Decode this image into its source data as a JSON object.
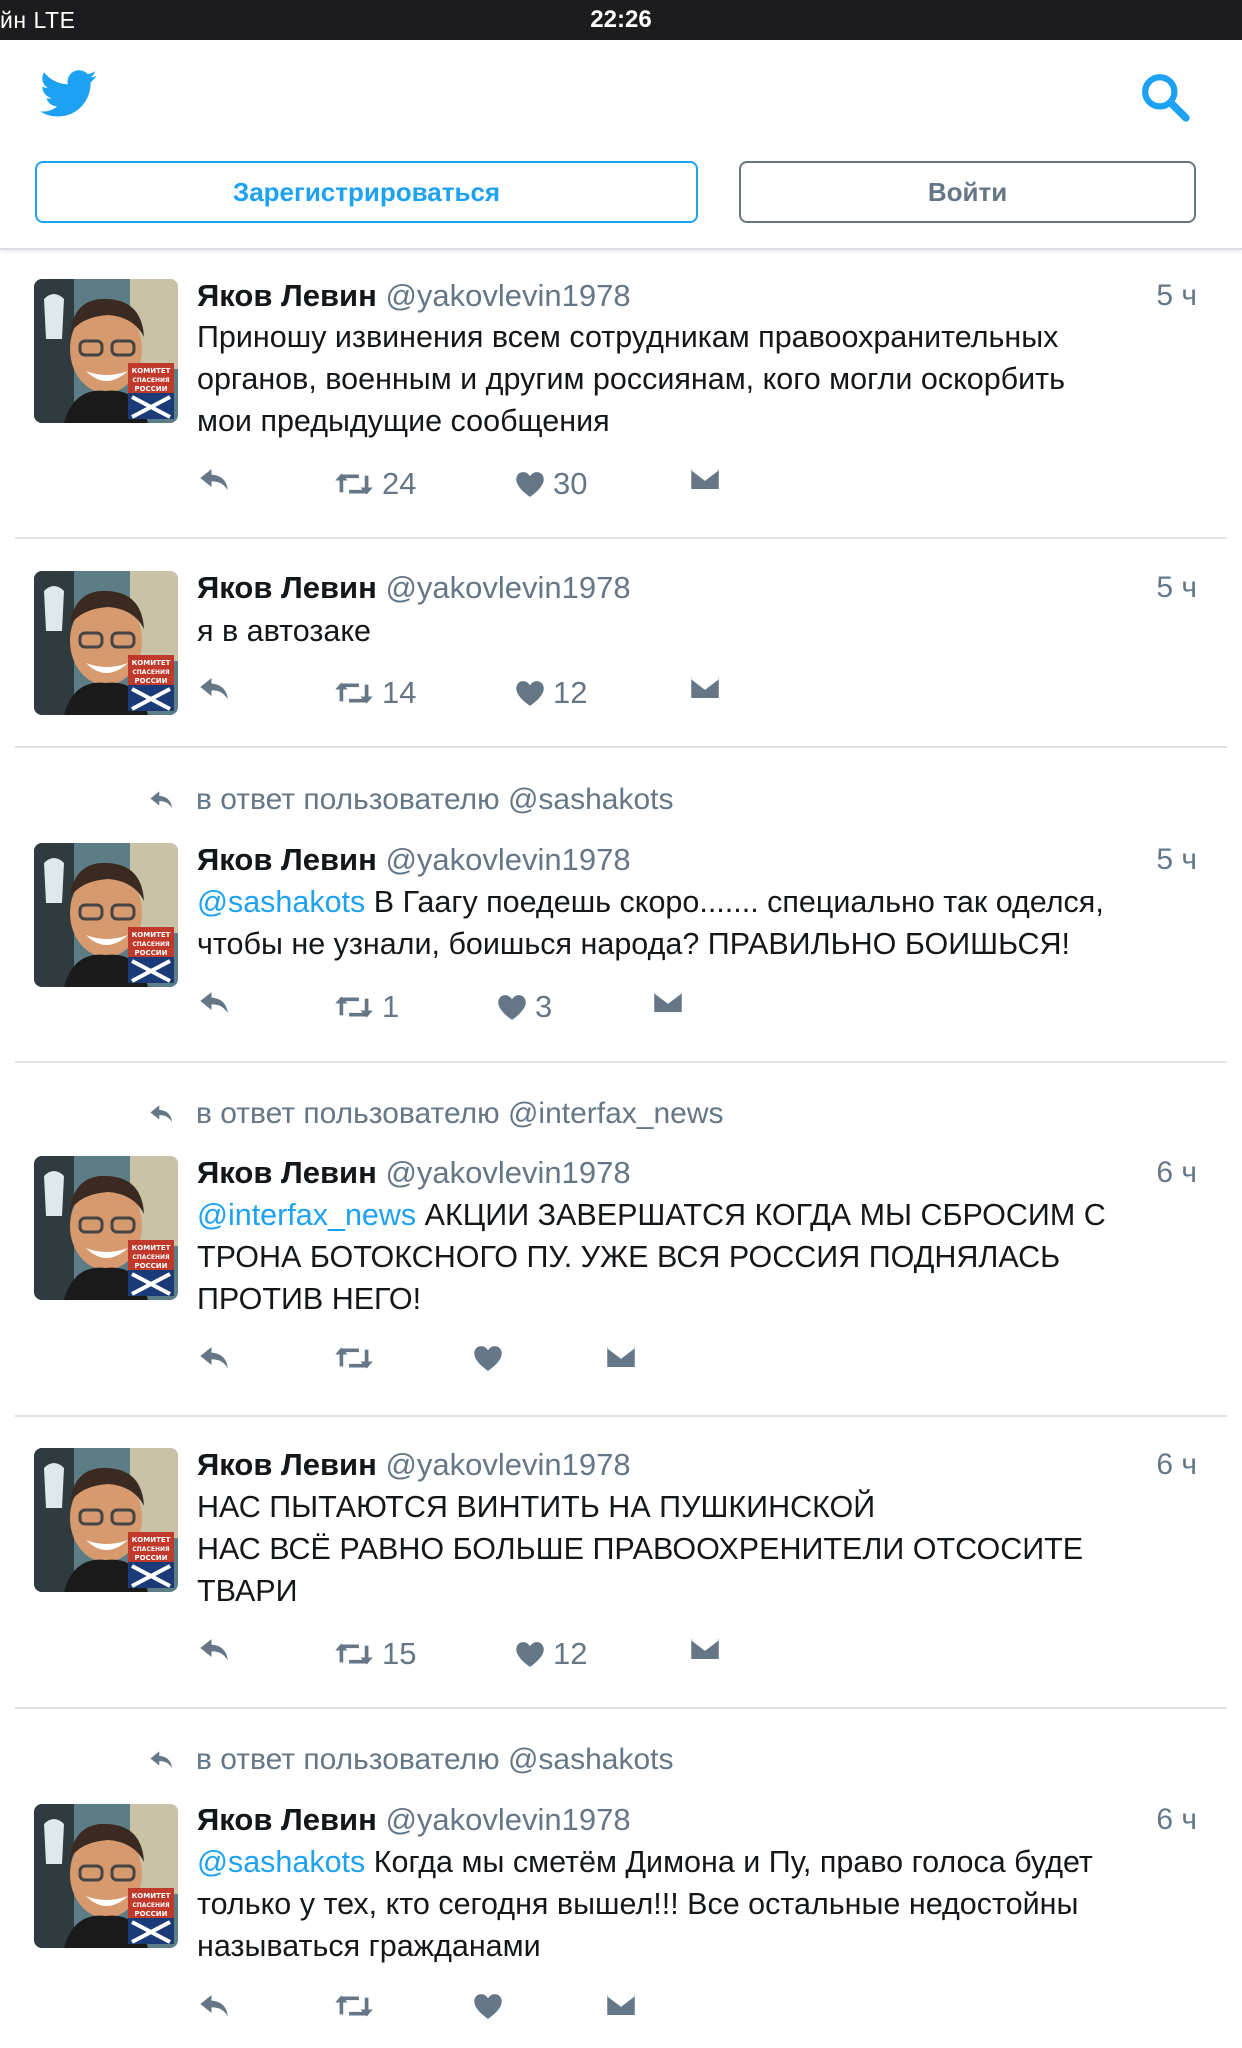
{
  "status_bar": {
    "carrier": "йн  LTE",
    "time": "22:26"
  },
  "header": {
    "signup_label": "Зарегистрироваться",
    "login_label": "Войти"
  },
  "tweets": [
    {
      "name": "Яков Левин",
      "handle": "@yakovlevin1978",
      "time": "5 ч",
      "reply_to": "",
      "mention": "",
      "lines": [
        "Приношу извинения всем сотрудникам правоохранительных",
        "органов, военным и другим россиянам, кого могли оскорбить",
        "мои предыдущие сообщения"
      ],
      "retweets": "24",
      "likes": "30"
    },
    {
      "name": "Яков Левин",
      "handle": "@yakovlevin1978",
      "time": "5 ч",
      "reply_to": "",
      "mention": "",
      "lines": [
        "я в автозаке"
      ],
      "retweets": "14",
      "likes": "12"
    },
    {
      "name": "Яков Левин",
      "handle": "@yakovlevin1978",
      "time": "5 ч",
      "reply_to": "в ответ пользователю @sashakots",
      "mention": "@sashakots",
      "lines": [
        " В Гаагу поедешь скоро....... специально так оделся,",
        "чтобы не узнали, боишься народа? ПРАВИЛЬНО БОИШЬСЯ!"
      ],
      "retweets": "1",
      "likes": "3"
    },
    {
      "name": "Яков Левин",
      "handle": "@yakovlevin1978",
      "time": "6 ч",
      "reply_to": "в ответ пользователю @interfax_news",
      "mention": "@interfax_news",
      "lines": [
        " АКЦИИ ЗАВЕРШАТСЯ КОГДА МЫ СБРОСИМ С",
        "ТРОНА БОТОКСНОГО ПУ. УЖЕ ВСЯ РОССИЯ ПОДНЯЛАСЬ",
        "ПРОТИВ НЕГО!"
      ],
      "retweets": "",
      "likes": ""
    },
    {
      "name": "Яков Левин",
      "handle": "@yakovlevin1978",
      "time": "6 ч",
      "reply_to": "",
      "mention": "",
      "lines": [
        "НАС ПЫТАЮТСЯ ВИНТИТЬ НА ПУШКИНСКОЙ",
        "НАС ВСЁ РАВНО БОЛЬШЕ ПРАВООХРЕНИТЕЛИ ОТСОСИТЕ",
        "ТВАРИ"
      ],
      "retweets": "15",
      "likes": "12"
    },
    {
      "name": "Яков Левин",
      "handle": "@yakovlevin1978",
      "time": "6 ч",
      "reply_to": "в ответ пользователю @sashakots",
      "mention": "@sashakots",
      "lines": [
        " Когда мы сметём Димона и Пу, право голоса будет",
        "только у тех, кто сегодня вышел!!! Все остальные недостойны",
        "называться гражданами"
      ],
      "retweets": "",
      "likes": ""
    }
  ],
  "avatar_badge": [
    "КОМИТЕТ",
    "СПАСЕНИЯ",
    "РОССИИ"
  ],
  "colors": {
    "accent": "#1da1f2",
    "muted": "#657786",
    "text": "#14171a",
    "divider": "#dfe3e7"
  },
  "icons": [
    "twitter-bird-icon",
    "search-icon",
    "reply-icon",
    "retweet-icon",
    "heart-icon",
    "direct-message-icon"
  ]
}
